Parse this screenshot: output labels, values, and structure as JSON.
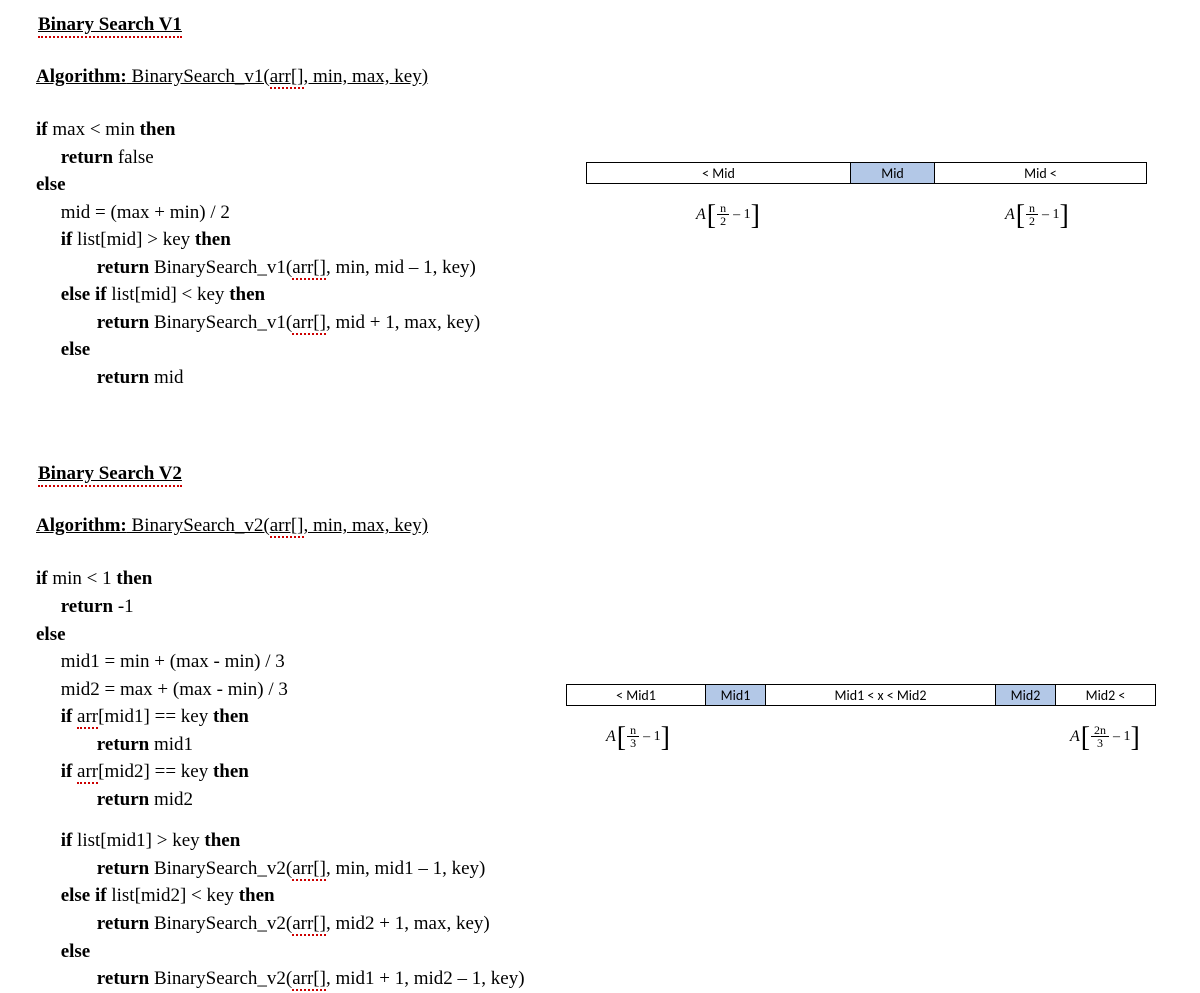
{
  "v1": {
    "title": "Binary Search V1",
    "algoLabel": "Algorithm:",
    "algoSig1": " BinarySearch_v1(",
    "arr": "arr[]",
    "algoSig2": ", min, max, key)",
    "lines": {
      "l1a": "if",
      "l1b": " max < min ",
      "l1c": "then",
      "l2a": "return",
      "l2b": " false",
      "l3": "else",
      "l4": "mid = (max + min) / 2",
      "l5a": "if",
      "l5b": " list[mid] > key ",
      "l5c": "then",
      "l6a": "return",
      "l6b": " BinarySearch_v1(",
      "l6c": ", min, mid – 1, key)",
      "l7a": "else if",
      "l7b": " list[mid] < key ",
      "l7c": "then",
      "l8a": "return",
      "l8b": " BinarySearch_v1(",
      "l8c": ", mid + 1, max, key)",
      "l9": "else",
      "l10a": "return",
      "l10b": " mid"
    },
    "diagram": {
      "labels": {
        "lt": "< Mid",
        "mid": "Mid",
        "gt": "Mid <"
      },
      "formula": {
        "A": "A",
        "num": "n",
        "den": "2",
        "tail": "– 1"
      }
    }
  },
  "v2": {
    "title": "Binary Search V2",
    "algoLabel": "Algorithm:",
    "algoSig1": " BinarySearch_v2(",
    "arr": "arr[]",
    "algoSig2": ", min, max, key)",
    "lines": {
      "l1a": "if",
      "l1b": " min < 1 ",
      "l1c": "then",
      "l2a": "return",
      "l2b": " -1",
      "l3": "else",
      "l4": "mid1 = min + (max - min) / 3",
      "l5": "mid2 = max + (max - min) / 3",
      "l6a": "if ",
      "l6arr": "arr",
      "l6b": "[mid1] == key ",
      "l6c": "then",
      "l7a": "return",
      "l7b": " mid1",
      "l8a": "if ",
      "l8arr": "arr",
      "l8b": "[mid2] == key ",
      "l8c": "then",
      "l9a": "return",
      "l9b": " mid2",
      "l10a": "if",
      "l10b": " list[mid1] > key ",
      "l10c": "then",
      "l11a": "return",
      "l11b": " BinarySearch_v2(",
      "l11c": ", min, mid1 – 1, key)",
      "l12a": "else if",
      "l12b": " list[mid2] < key ",
      "l12c": "then",
      "l13a": "return",
      "l13b": " BinarySearch_v2(",
      "l13c": ", mid2 + 1, max, key)",
      "l14": "else",
      "l15a": "return",
      "l15b": " BinarySearch_v2(",
      "l15c": ", mid1 + 1, mid2 – 1, key)"
    },
    "diagram": {
      "labels": {
        "lt": "< Mid1",
        "m1": "Mid1",
        "between": "Mid1 < x < Mid2",
        "m2": "Mid2",
        "gt": "Mid2 <"
      },
      "formulaL": {
        "A": "A",
        "num": "n",
        "den": "3",
        "tail": "– 1"
      },
      "formulaR": {
        "A": "A",
        "num": "2n",
        "den": "3",
        "tail": "– 1"
      }
    }
  }
}
